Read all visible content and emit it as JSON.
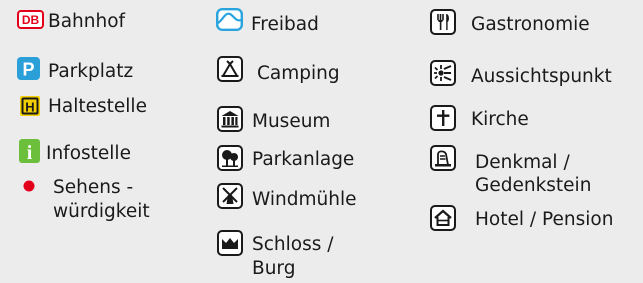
{
  "legend": {
    "col1": {
      "bahnhof": "Bahnhof",
      "bahnhof_badge": "DB",
      "parkplatz": "Parkplatz",
      "parkplatz_badge": "P",
      "haltestelle": "Haltestelle",
      "haltestelle_badge": "H",
      "infostelle": "Infostelle",
      "infostelle_badge": "i",
      "sehens_line1": "Sehens -",
      "sehens_line2": "würdigkeit"
    },
    "col2": {
      "freibad": "Freibad",
      "camping": "Camping",
      "museum": "Museum",
      "parkanlage": "Parkanlage",
      "windmuehle": "Windmühle",
      "schloss_line1": "Schloss /",
      "schloss_line2": "Burg"
    },
    "col3": {
      "gastronomie": "Gastronomie",
      "aussichtspunkt": "Aussichtspunkt",
      "kirche": "Kirche",
      "denkmal_line1": "Denkmal /",
      "denkmal_line2": "Gedenkstein",
      "hotel": "Hotel / Pension"
    }
  },
  "colors": {
    "background": "#ececec",
    "db_red": "#e3001b",
    "parking_blue": "#2a9fd8",
    "halt_yellow": "#f5d000",
    "info_green": "#6cbf3a",
    "poi_red": "#e3001b",
    "freibad_blue": "#2aa4de"
  }
}
